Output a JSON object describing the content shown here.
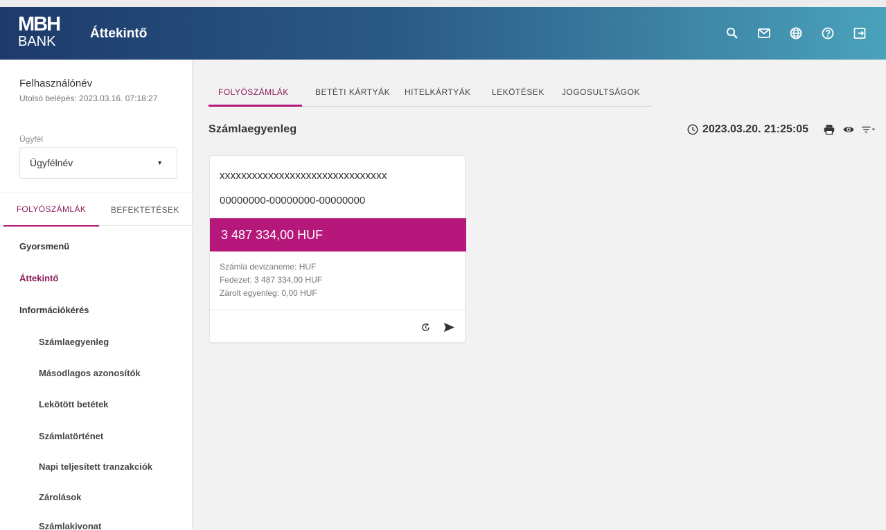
{
  "header": {
    "logo_line1": "MBH",
    "logo_line2": "BANK",
    "title": "Áttekintő",
    "icons": [
      "search-icon",
      "mail-icon",
      "globe-icon",
      "help-icon",
      "logout-icon"
    ]
  },
  "user": {
    "name": "Felhasználónév",
    "last_login": "Utolsó belépés: 2023.03.16. 07:18:27"
  },
  "client": {
    "label": "Ügyfél",
    "value": "Ügyfélnév"
  },
  "sidebar": {
    "tabs": [
      {
        "label": "FOLYÓSZÁMLÁK",
        "active": true
      },
      {
        "label": "BEFEKTETÉSEK",
        "active": false
      }
    ],
    "menu": [
      {
        "label": "Gyorsmenü"
      },
      {
        "label": "Áttekintő"
      },
      {
        "label": "Információkérés"
      },
      {
        "label": "Számlaegyenleg"
      },
      {
        "label": "Másodlagos azonosítók"
      },
      {
        "label": "Lekötött betétek"
      },
      {
        "label": "Számlatörténet"
      },
      {
        "label": "Napi teljesített tranzakciók"
      },
      {
        "label": "Zárolások"
      },
      {
        "label": "Számlakivonat"
      }
    ]
  },
  "main": {
    "tabs": [
      {
        "label": "FOLYÓSZÁMLÁK"
      },
      {
        "label": "BETÉTI KÁRTYÁK"
      },
      {
        "label": "HITELKÁRTYÁK"
      },
      {
        "label": "LEKÖTÉSEK"
      },
      {
        "label": "JOGOSULTSÁGOK"
      }
    ],
    "section_title": "Számlaegyenleg",
    "timestamp": "2023.03.20. 21:25:05"
  },
  "account": {
    "name": "xxxxxxxxxxxxxxxxxxxxxxxxxxxxxxx",
    "number": "00000000-00000000-00000000",
    "balance": "3 487 334,00 HUF",
    "currency_line": "Számla devizaneme: HUF",
    "coverage_line": "Fedezet: 3 487 334,00 HUF",
    "blocked_line": "Zárolt egyenleg: 0,00 HUF"
  },
  "colors": {
    "accent": "#b5177a",
    "header_start": "#1d3a6a",
    "header_end": "#4aa2bb"
  }
}
